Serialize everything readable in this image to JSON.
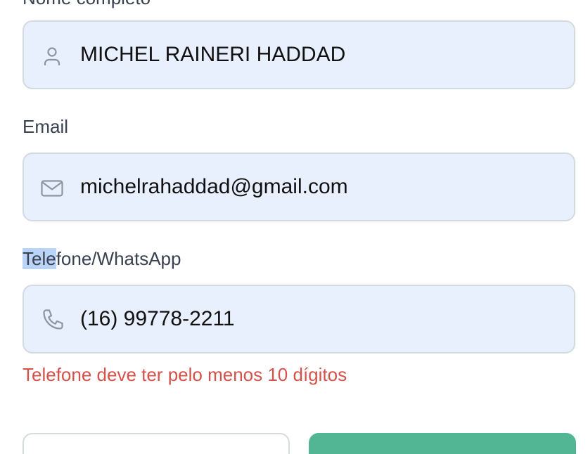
{
  "form": {
    "fields": {
      "name": {
        "label": "Nome completo",
        "value": "MICHEL RAINERI HADDAD",
        "icon": "user-icon"
      },
      "email": {
        "label": "Email",
        "value": "michelrahaddad@gmail.com",
        "icon": "mail-icon"
      },
      "phone": {
        "label_selected": "Tele",
        "label_rest": "fone/WhatsApp",
        "value": "(16) 99778-2211",
        "icon": "phone-icon",
        "error": "Telefone deve ter pelo menos 10 dígitos"
      }
    }
  },
  "colors": {
    "field_background": "#e8effd",
    "field_border": "#d5d9e0",
    "error": "#d4524a",
    "primary_button": "#52b593",
    "text_selection": "#b9d4f6"
  }
}
